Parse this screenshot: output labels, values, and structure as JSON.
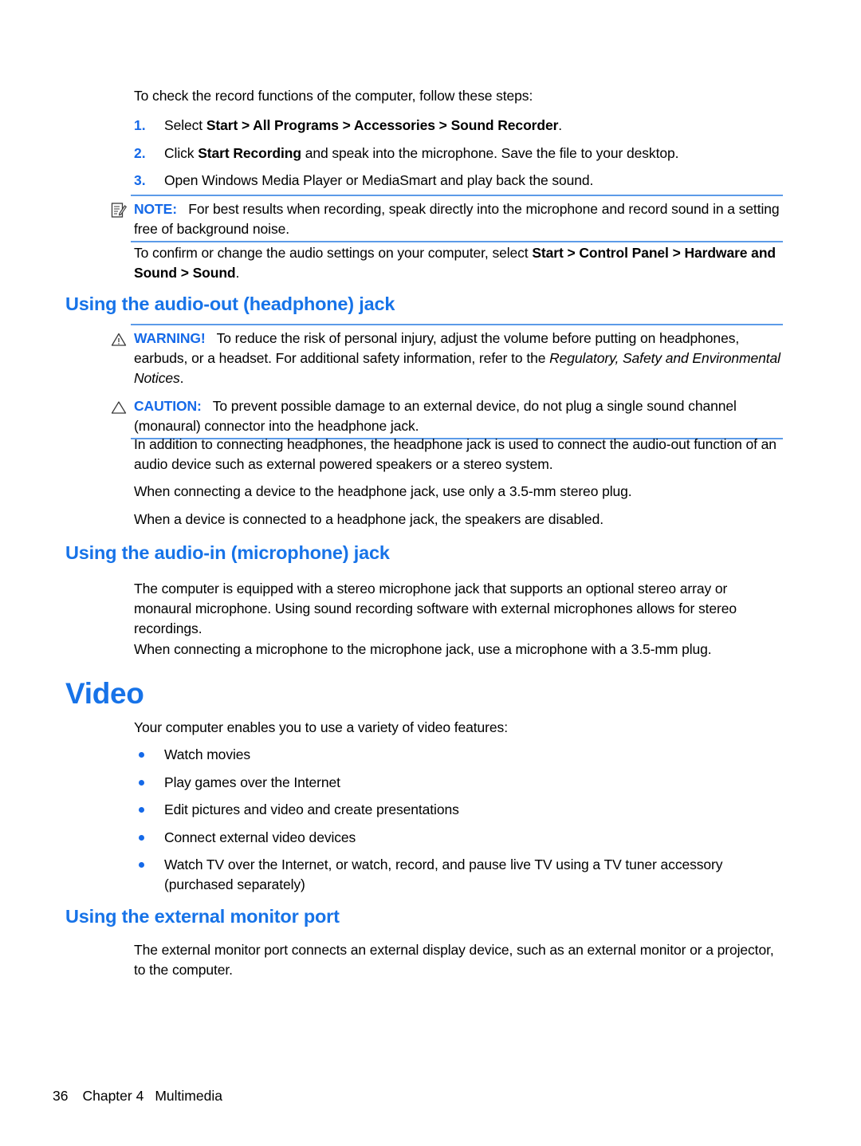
{
  "colors": {
    "heading_blue": "#1773E8",
    "accent_blue": "#1569E8",
    "rule_blue": "#5C9BE8",
    "text_black": "#000000",
    "page_background": "#FFFFFF"
  },
  "intro": {
    "paragraph": "To check the record functions of the computer, follow these steps:"
  },
  "steps": [
    {
      "number": "1.",
      "prefix": "Select ",
      "bold": "Start > All Programs > Accessories > Sound Recorder",
      "suffix": "."
    },
    {
      "number": "2.",
      "prefix": "Click ",
      "bold": "Start Recording",
      "suffix": " and speak into the microphone. Save the file to your desktop."
    },
    {
      "number": "3.",
      "prefix": "Open Windows Media Player or MediaSmart and play back the sound.",
      "bold": "",
      "suffix": ""
    }
  ],
  "note": {
    "icon": "note-icon",
    "label": "NOTE:",
    "text": "For best results when recording, speak directly into the microphone and record sound in a setting free of background noise."
  },
  "confirm_paragraph": {
    "prefix": "To confirm or change the audio settings on your computer, select ",
    "bold": "Start > Control Panel > Hardware and Sound > Sound",
    "suffix": "."
  },
  "section_headphone": {
    "heading": "Using the audio-out (headphone) jack",
    "warning": {
      "icon": "warning-triangle-icon",
      "label": "WARNING!",
      "text_before_italic": "To reduce the risk of personal injury, adjust the volume before putting on headphones, earbuds, or a headset. For additional safety information, refer to the ",
      "italic": "Regulatory, Safety and Environmental Notices",
      "text_after_italic": "."
    },
    "caution": {
      "icon": "caution-triangle-icon",
      "label": "CAUTION:",
      "text": "To prevent possible damage to an external device, do not plug a single sound channel (monaural) connector into the headphone jack."
    },
    "paragraphs": [
      "In addition to connecting headphones, the headphone jack is used to connect the audio-out function of an audio device such as external powered speakers or a stereo system.",
      "When connecting a device to the headphone jack, use only a 3.5-mm stereo plug.",
      "When a device is connected to a headphone jack, the speakers are disabled."
    ]
  },
  "section_microphone": {
    "heading": "Using the audio-in (microphone) jack",
    "paragraphs": [
      "The computer is equipped with a stereo microphone jack that supports an optional stereo array or monaural microphone. Using sound recording software with external microphones allows for stereo recordings.",
      "When connecting a microphone to the microphone jack, use a microphone with a 3.5-mm plug."
    ]
  },
  "section_video": {
    "heading": "Video",
    "intro": "Your computer enables you to use a variety of video features:",
    "bullets": [
      "Watch movies",
      "Play games over the Internet",
      "Edit pictures and video and create presentations",
      "Connect external video devices",
      "Watch TV over the Internet, or watch, record, and pause live TV using a TV tuner accessory (purchased separately)"
    ]
  },
  "section_monitor": {
    "heading": "Using the external monitor port",
    "paragraphs": [
      "The external monitor port connects an external display device, such as an external monitor or a projector, to the computer."
    ]
  },
  "footer": {
    "page_number": "36",
    "chapter": "Chapter 4",
    "chapter_title": "Multimedia"
  }
}
